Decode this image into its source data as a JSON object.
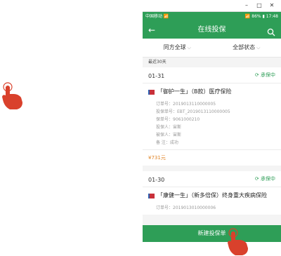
{
  "window": {
    "minimize": "–",
    "maximize": "□",
    "close": "✕"
  },
  "statusbar": {
    "left": "中国移动 📶",
    "right": "📶 86% ▮ 17:48"
  },
  "header": {
    "title": "在线投保",
    "back_icon": "arrow-left-icon",
    "search_icon": "search-icon"
  },
  "filters": [
    {
      "label": "同方全球",
      "caret": "⌵"
    },
    {
      "label": "全部状态",
      "caret": "⌵"
    }
  ],
  "section_label": "最近30天",
  "cards": [
    {
      "date": "01-31",
      "status": "⟳ 承保中",
      "product": "「御护一生」（B款）医疗保险",
      "fields": [
        "订单号：2019013110000005",
        "投保单号：EBT_2019013110000005",
        "保单号：9061000210",
        "投保人：宙斯",
        "被保人：宙斯",
        "备    注：成功"
      ],
      "price": "¥731元"
    },
    {
      "date": "01-30",
      "status": "⟳ 承保中",
      "product": "「康健一生」（新多倍保）终身重大疾病保险",
      "fields": [
        "订单号：2019013010000006"
      ]
    }
  ],
  "bottom_button": "新建投保单",
  "colors": {
    "brand_green": "#2e9e57",
    "price_orange": "#e0862a",
    "hand_red": "#d9412c"
  }
}
